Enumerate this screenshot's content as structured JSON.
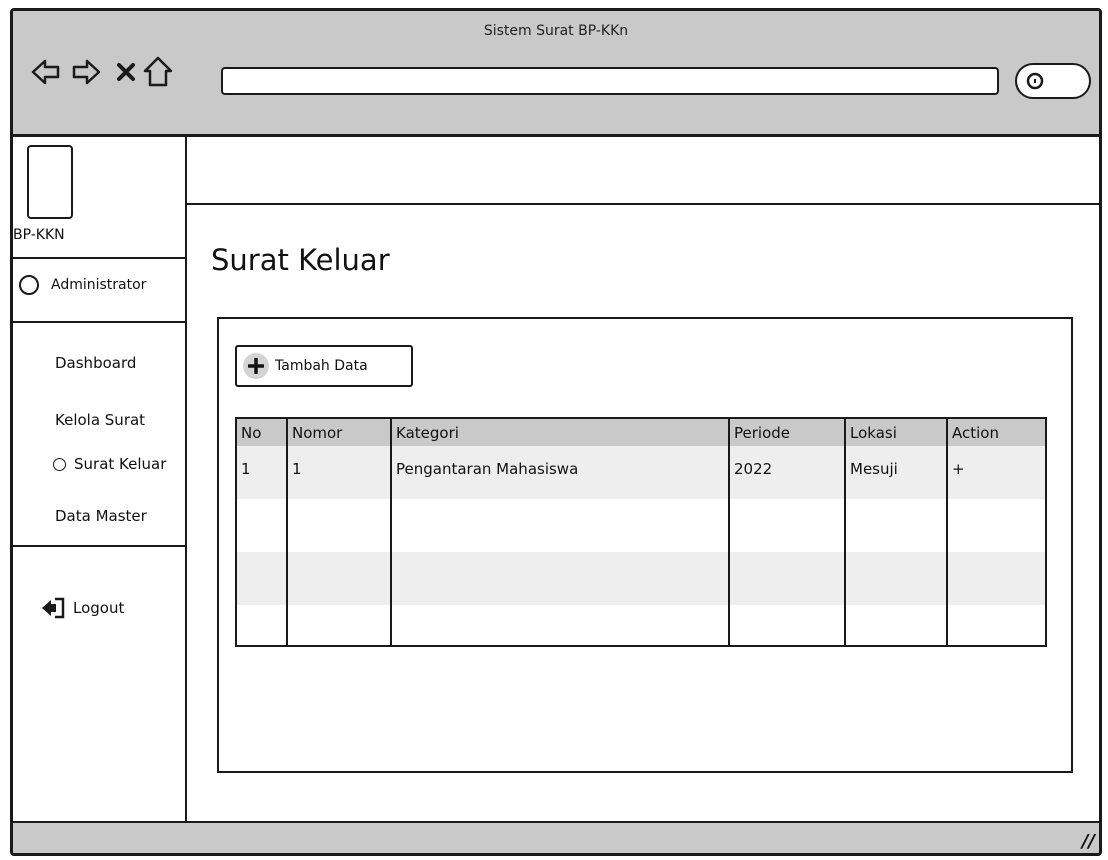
{
  "window": {
    "title": "Sistem Surat BP-KKn"
  },
  "icons": {
    "back": "back-arrow-icon",
    "forward": "forward-arrow-icon",
    "stop": "close-icon",
    "home": "home-icon",
    "search": "search-icon",
    "add": "plus-icon",
    "logout": "logout-icon",
    "resize": "resize-grip-icon"
  },
  "sidebar": {
    "brand": "BP-KKN",
    "user": "Administrator",
    "menu": [
      {
        "label": "Dashboard"
      },
      {
        "label": "Kelola Surat"
      },
      {
        "label": "Data Master"
      }
    ],
    "submenu": [
      {
        "label": "Surat Keluar"
      }
    ],
    "logout": "Logout"
  },
  "main": {
    "title": "Surat Keluar",
    "add_button": "Tambah Data",
    "table": {
      "columns": [
        "No",
        "Nomor",
        "Kategori",
        "Periode",
        "Lokasi",
        "Action"
      ],
      "rows": [
        [
          "1",
          "1",
          "Pengantaran Mahasiswa",
          "2022",
          "Mesuji",
          "+"
        ]
      ]
    }
  },
  "statusbar": {
    "grip": "//"
  },
  "colors": {
    "chrome": "#c9c9c9",
    "stripe": "#eeeeee",
    "border": "#1a1a1a"
  }
}
